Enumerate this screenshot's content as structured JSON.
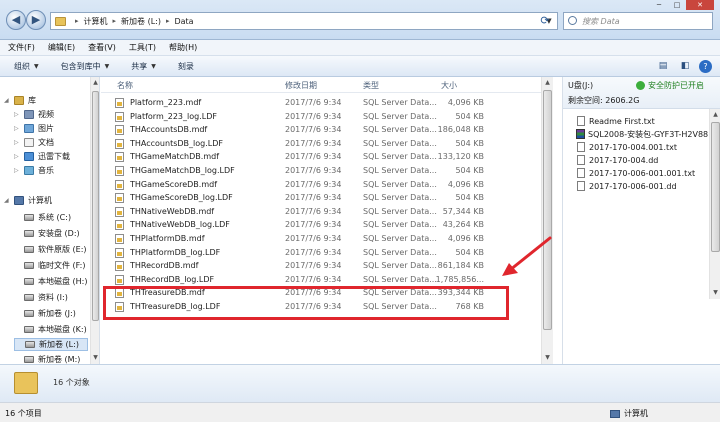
{
  "address_bar": {
    "crumbs": [
      "计算机",
      "新加卷 (L:)",
      "Data"
    ],
    "search_placeholder": "搜索 Data"
  },
  "menu": [
    "文件(F)",
    "编辑(E)",
    "查看(V)",
    "工具(T)",
    "帮助(H)"
  ],
  "toolbar": {
    "organize": "组织",
    "include_in_library": "包含到库中",
    "share": "共享",
    "burn": "刻录"
  },
  "nav": {
    "library": "库",
    "video": "视频",
    "pictures": "图片",
    "documents": "文档",
    "thunder": "迅雷下载",
    "music": "音乐",
    "computer": "计算机",
    "drives": [
      "系统 (C:)",
      "安装盘 (D:)",
      "软件原版 (E:)",
      "临时文件 (F:)",
      "本地磁盘 (H:)",
      "资料 (I:)",
      "新加卷 (J:)",
      "本地磁盘 (K:)",
      "新加卷 (L:)",
      "新加卷 (M:)"
    ]
  },
  "columns": {
    "name": "名称",
    "date": "修改日期",
    "type": "类型",
    "size": "大小"
  },
  "files": [
    {
      "name": "Platform_223.mdf",
      "date": "2017/7/6 9:34",
      "type": "SQL Server Data...",
      "size": "4,096 KB"
    },
    {
      "name": "Platform_223_log.LDF",
      "date": "2017/7/6 9:34",
      "type": "SQL Server Data...",
      "size": "504 KB"
    },
    {
      "name": "THAccountsDB.mdf",
      "date": "2017/7/6 9:34",
      "type": "SQL Server Data...",
      "size": "186,048 KB"
    },
    {
      "name": "THAccountsDB_log.LDF",
      "date": "2017/7/6 9:34",
      "type": "SQL Server Data...",
      "size": "504 KB"
    },
    {
      "name": "THGameMatchDB.mdf",
      "date": "2017/7/6 9:34",
      "type": "SQL Server Data...",
      "size": "133,120 KB"
    },
    {
      "name": "THGameMatchDB_log.LDF",
      "date": "2017/7/6 9:34",
      "type": "SQL Server Data...",
      "size": "504 KB"
    },
    {
      "name": "THGameScoreDB.mdf",
      "date": "2017/7/6 9:34",
      "type": "SQL Server Data...",
      "size": "4,096 KB"
    },
    {
      "name": "THGameScoreDB_log.LDF",
      "date": "2017/7/6 9:34",
      "type": "SQL Server Data...",
      "size": "504 KB"
    },
    {
      "name": "THNativeWebDB.mdf",
      "date": "2017/7/6 9:34",
      "type": "SQL Server Data...",
      "size": "57,344 KB"
    },
    {
      "name": "THNativeWebDB_log.LDF",
      "date": "2017/7/6 9:34",
      "type": "SQL Server Data...",
      "size": "43,264 KB"
    },
    {
      "name": "THPlatformDB.mdf",
      "date": "2017/7/6 9:34",
      "type": "SQL Server Data...",
      "size": "4,096 KB"
    },
    {
      "name": "THPlatformDB_log.LDF",
      "date": "2017/7/6 9:34",
      "type": "SQL Server Data...",
      "size": "504 KB"
    },
    {
      "name": "THRecordDB.mdf",
      "date": "2017/7/6 9:34",
      "type": "SQL Server Data...",
      "size": "861,184 KB"
    },
    {
      "name": "THRecordDB_log.LDF",
      "date": "2017/7/6 9:34",
      "type": "SQL Server Data...",
      "size": "1,785,856..."
    },
    {
      "name": "THTreasureDB.mdf",
      "date": "2017/7/6 9:34",
      "type": "SQL Server Data...",
      "size": "393,344 KB"
    },
    {
      "name": "THTreasureDB_log.LDF",
      "date": "2017/7/6 9:34",
      "type": "SQL Server Data...",
      "size": "768 KB"
    }
  ],
  "preview": {
    "drive": "U盘(J:)",
    "safe_label": "安全防护已开启",
    "free_space": "剩余空间: 2606.2G",
    "files": [
      "Readme First.txt",
      "SQL2008-安装包-GYF3T-H2V88...",
      "2017-170-004.001.txt",
      "2017-170-004.dd",
      "2017-170-006-001.001.txt",
      "2017-170-006-001.dd"
    ]
  },
  "details": {
    "count": "16 个对象"
  },
  "status": {
    "count": "16 个项目",
    "location": "计算机"
  },
  "colors": {
    "highlight": "#e0262d",
    "arrow": "#e0262d"
  }
}
